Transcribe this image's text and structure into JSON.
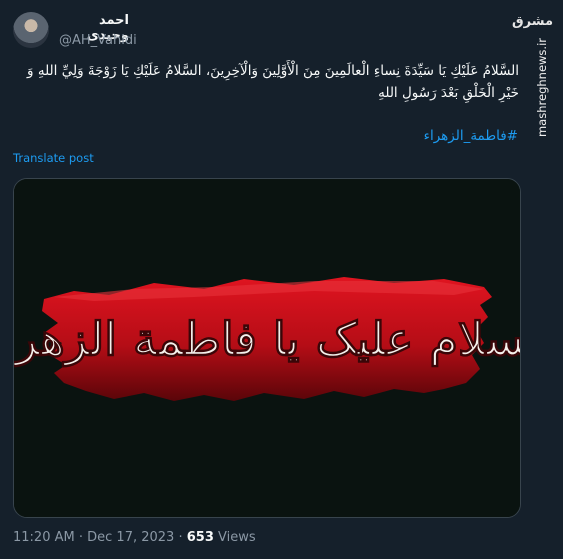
{
  "author": {
    "display_name": "احمد وحیدی",
    "handle": "@AH_Vahidi"
  },
  "tweet": {
    "text": "السَّلامُ عَلَيْكِ يَا سَيِّدَةَ نِساءِ الْعالَمِينَ مِنَ الْأَوَّلِينَ وَالْآخِرِينَ، السَّلامُ عَلَيْكِ يَا زَوْجَةَ وَلِيِّ اللهِ وَ خَيْرِ الْخَلْقِ بَعْدَ رَسُولِ اللهِ",
    "hashtag": "#فاطمة_الزهراء",
    "translate_label": "Translate post",
    "time": "11:20 AM",
    "date": "Dec 17, 2023",
    "separator": "·",
    "views_count": "653",
    "views_label": "Views"
  },
  "media": {
    "calligraphy": "السلام علیک یا فاطمة الزهراء",
    "brush_color": "#c8101c",
    "background_color": "#0a1310"
  },
  "watermark": {
    "logo": "مشرق",
    "site": "mashreghnews.ir"
  }
}
